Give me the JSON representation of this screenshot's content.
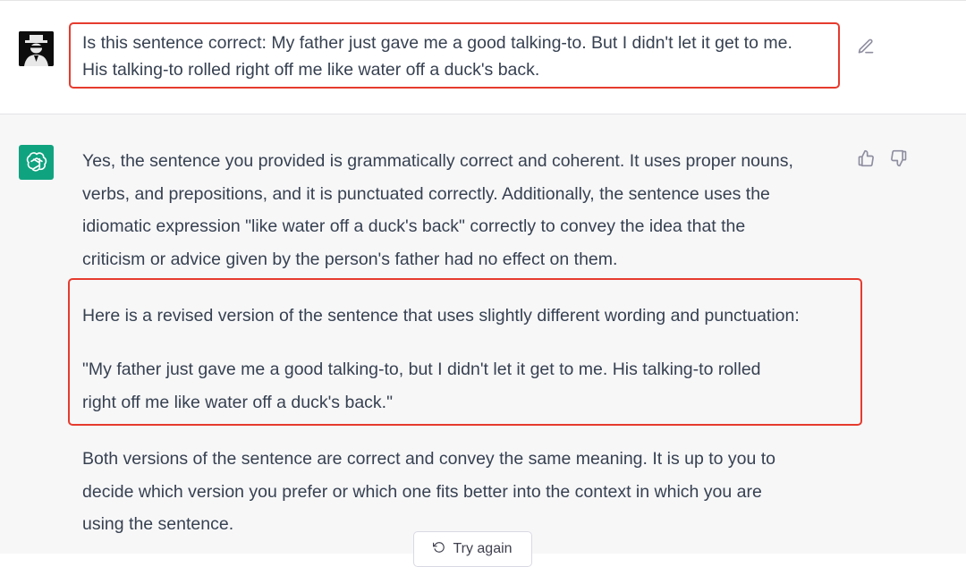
{
  "user_message": {
    "lines": [
      "Is this sentence correct: My father just gave me a good talking-to. But I didn't let it get to me.",
      "His talking-to rolled right off me like water off a duck's back."
    ]
  },
  "assistant_message": {
    "para1_lines": [
      "Yes, the sentence you provided is grammatically correct and coherent. It uses proper nouns,",
      "verbs, and prepositions, and it is punctuated correctly. Additionally, the sentence uses the",
      "idiomatic expression \"like water off a duck's back\" correctly to convey the idea that the",
      "criticism or advice given by the person's father had no effect on them."
    ],
    "para2_line": "Here is a revised version of the sentence that uses slightly different wording and punctuation:",
    "para3_lines": [
      "\"My father just gave me a good talking-to, but I didn't let it get to me. His talking-to rolled",
      "right off me like water off a duck's back.\""
    ],
    "para4_lines": [
      "Both versions of the sentence are correct and convey the same meaning. It is up to you to",
      "decide which version you prefer or which one fits better into the context in which you are",
      "using the sentence."
    ]
  },
  "controls": {
    "try_again_label": "Try again"
  },
  "colors": {
    "highlight": "#e63b2e",
    "assistant_avatar": "#10a37f"
  },
  "icons": [
    "user-avatar",
    "chatgpt-logo-icon",
    "edit-icon",
    "thumbs-up-icon",
    "thumbs-down-icon",
    "regenerate-icon"
  ]
}
